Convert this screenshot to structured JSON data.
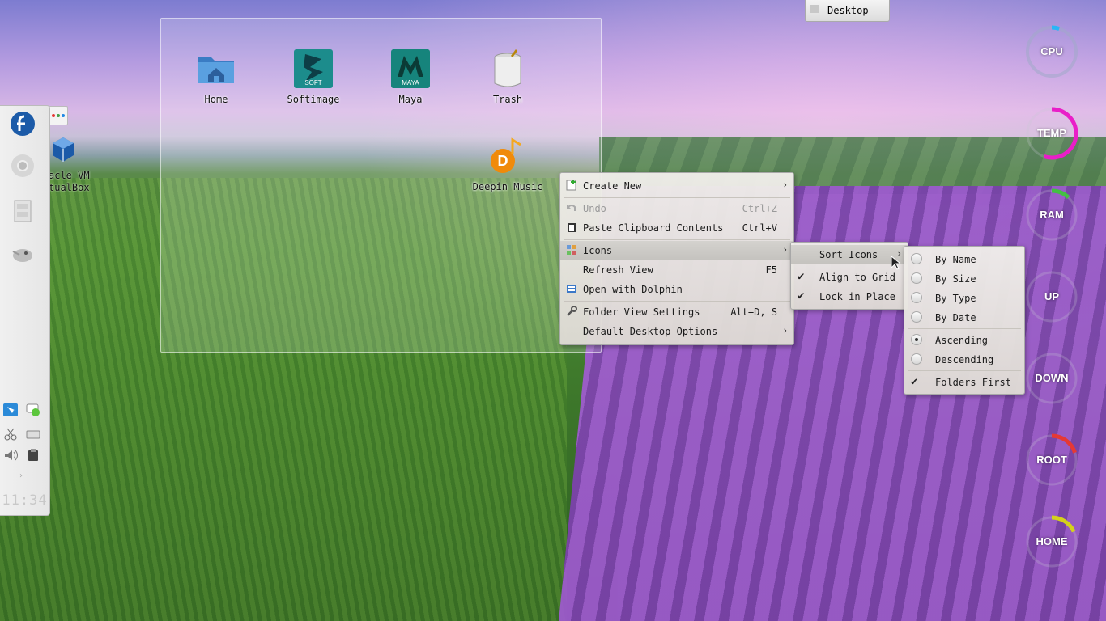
{
  "desktop": {
    "top_tab_label": "Desktop",
    "clock": "11:34"
  },
  "folder_icons": [
    {
      "label": "Home"
    },
    {
      "label": "Softimage",
      "badge": "SOFT"
    },
    {
      "label": "Maya",
      "badge": "MAYA"
    },
    {
      "label": "Trash"
    },
    {
      "label": "Deepin Music"
    }
  ],
  "partial_icon": {
    "line1": "acle VM",
    "line2": "tualBox"
  },
  "context_menu": {
    "items": [
      {
        "label": "Create New",
        "shortcut": "",
        "has_submenu": true
      },
      {
        "label": "Undo",
        "shortcut": "Ctrl+Z",
        "disabled": true
      },
      {
        "label": "Paste Clipboard Contents",
        "shortcut": "Ctrl+V"
      },
      {
        "label": "Icons",
        "shortcut": "",
        "has_submenu": true,
        "highlighted": true
      },
      {
        "label": "Refresh View",
        "shortcut": "F5"
      },
      {
        "label": "Open with Dolphin",
        "shortcut": ""
      },
      {
        "label": "Folder View Settings",
        "shortcut": "Alt+D, S"
      },
      {
        "label": "Default Desktop Options",
        "shortcut": "",
        "has_submenu": true
      }
    ]
  },
  "icons_submenu": {
    "items": [
      {
        "label": "Sort Icons",
        "has_submenu": true,
        "highlighted": true
      },
      {
        "label": "Align to Grid",
        "checked": true
      },
      {
        "label": "Lock in Place",
        "checked": true
      }
    ]
  },
  "sort_submenu": {
    "items": [
      {
        "label": "By Name",
        "selected": false
      },
      {
        "label": "By Size",
        "selected": false
      },
      {
        "label": "By Type",
        "selected": false
      },
      {
        "label": "By Date",
        "selected": false
      },
      {
        "label": "Ascending",
        "selected": true
      },
      {
        "label": "Descending",
        "selected": false
      },
      {
        "label": "Folders First",
        "checked": true
      }
    ]
  },
  "gauges": [
    {
      "label": "CPU",
      "color": "#29b6f6",
      "level": 0.05
    },
    {
      "label": "TEMP",
      "color": "#e91ec8",
      "level": 0.55
    },
    {
      "label": "RAM",
      "color": "#43c043",
      "level": 0.12
    },
    {
      "label": "UP",
      "color": "#888888",
      "level": 0.0
    },
    {
      "label": "DOWN",
      "color": "#888888",
      "level": 0.0
    },
    {
      "label": "ROOT",
      "color": "#e53935",
      "level": 0.2
    },
    {
      "label": "HOME",
      "color": "#d4d21a",
      "level": 0.18
    }
  ],
  "arrow_glyph": "›",
  "check_glyph": "✔"
}
